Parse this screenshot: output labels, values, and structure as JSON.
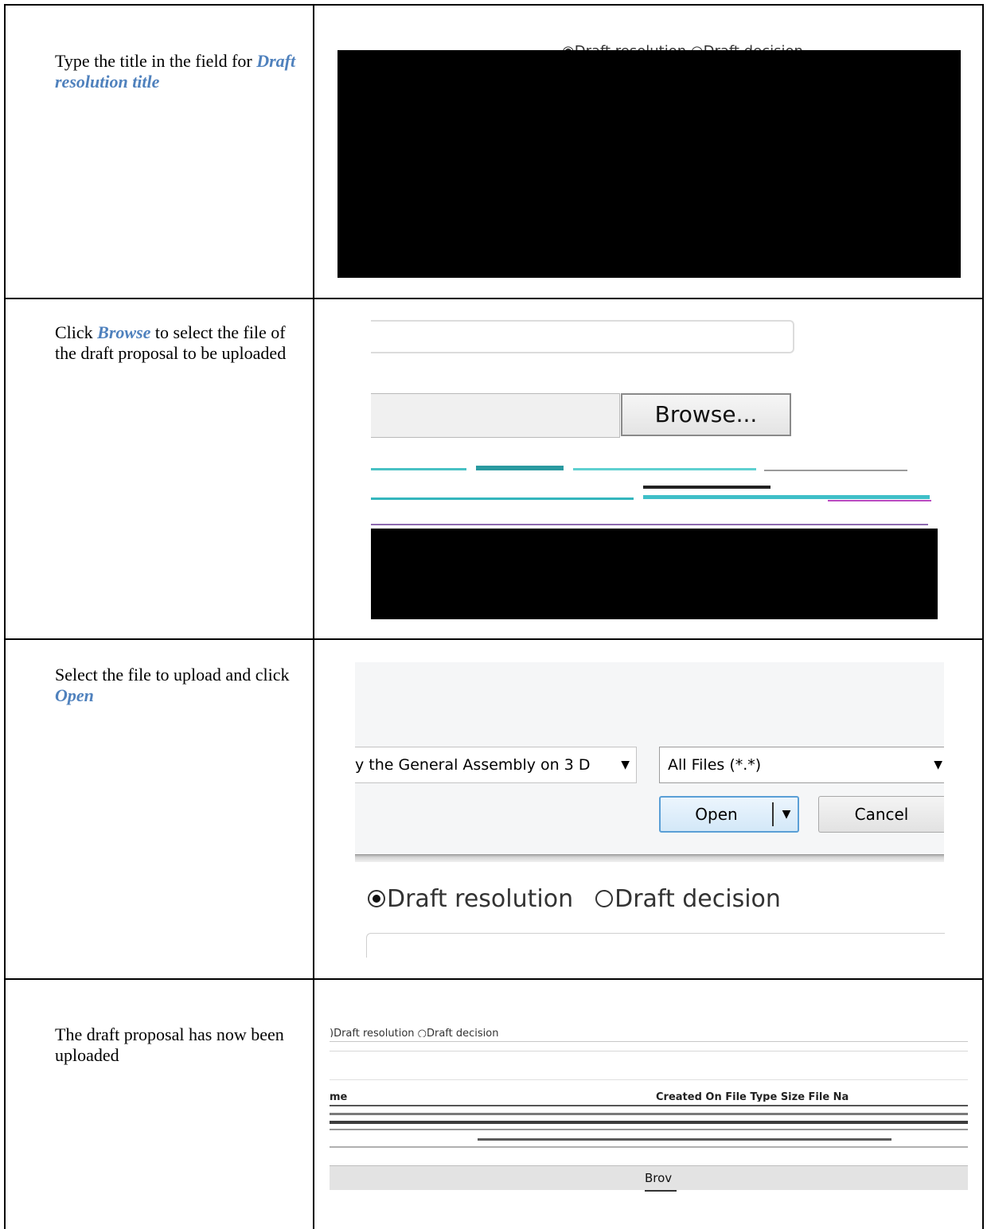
{
  "rows": [
    {
      "instruction_before": "Type the title in the field for ",
      "instruction_keyword": "Draft resolution title",
      "instruction_after": "",
      "screenshot": {
        "visible_text": "◉Draft resolution ○Draft decision"
      }
    },
    {
      "instruction_before": "Click ",
      "instruction_keyword": "Browse",
      "instruction_after": " to select the file of the draft proposal to be uploaded",
      "screenshot": {
        "browse_button_label": "Browse..."
      }
    },
    {
      "instruction_before": "Select the file to upload and click ",
      "instruction_keyword": "Open",
      "instruction_after": "",
      "screenshot": {
        "file_name_value": "y the General Assembly on 3 D",
        "file_type_filter": "All Files (*.*)",
        "open_button_label": "Open",
        "cancel_button_label": "Cancel",
        "radio_resolution_label": "Draft resolution",
        "radio_decision_label": "Draft decision",
        "selected_radio": "Draft resolution"
      }
    },
    {
      "instruction_before": "The draft proposal has now been uploaded",
      "instruction_keyword": "",
      "instruction_after": "",
      "screenshot": {
        "radio_text": ")Draft resolution   ○Draft decision",
        "header_left": "me",
        "header_right": "Created On  File Type                     Size  File Na",
        "browse_label": "Brov"
      }
    }
  ],
  "colors": {
    "keyword": "#4f81bd",
    "redaction": "#000000"
  }
}
